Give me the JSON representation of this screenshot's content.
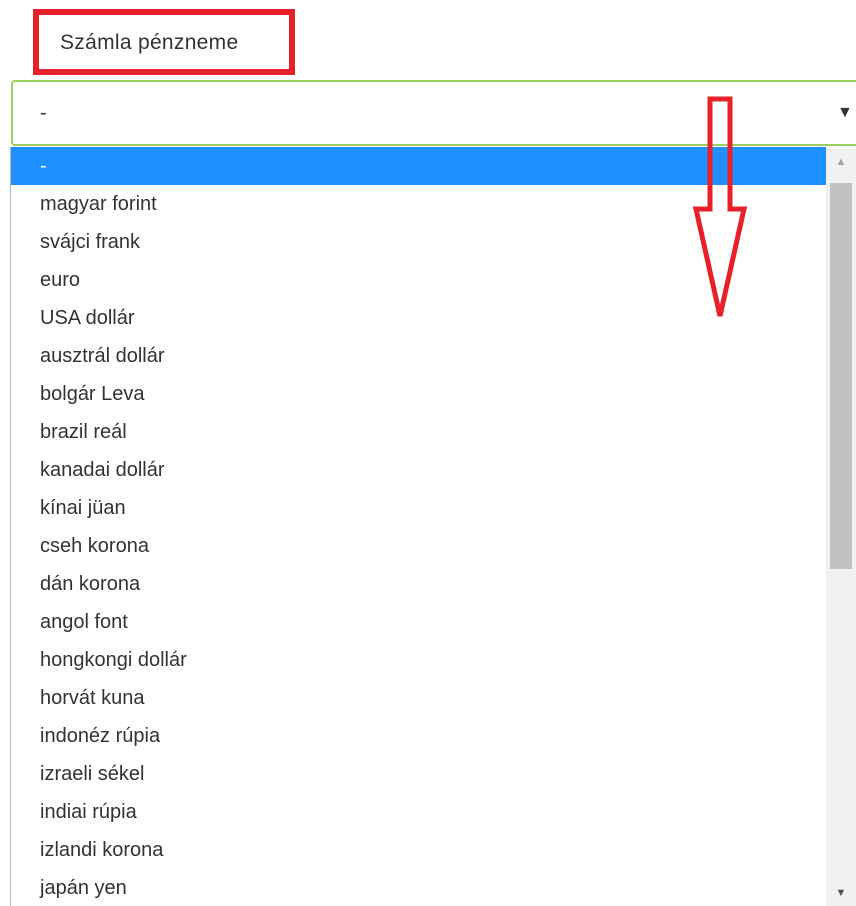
{
  "field": {
    "label": "Számla pénzneme",
    "selected_value": "-",
    "arrow_glyph": "▼"
  },
  "dropdown": {
    "options": [
      "-",
      "magyar forint",
      "svájci frank",
      "euro",
      "USA dollár",
      "ausztrál dollár",
      "bolgár Leva",
      "brazil reál",
      "kanadai dollár",
      "kínai jüan",
      "cseh korona",
      "dán korona",
      "angol font",
      "hongkongi dollár",
      "horvát kuna",
      "indonéz rúpia",
      "izraeli sékel",
      "indiai rúpia",
      "izlandi korona",
      "japán yen"
    ],
    "highlighted_index": 0
  },
  "scrollbar": {
    "up_glyph": "▲",
    "down_glyph": "▼"
  },
  "annotation": {
    "highlight_color": "#e8202a",
    "arrow_icon": "down-arrow-outline-icon"
  },
  "colors": {
    "option_highlight": "#1e90ff",
    "select_border": "#9ccf5e"
  }
}
